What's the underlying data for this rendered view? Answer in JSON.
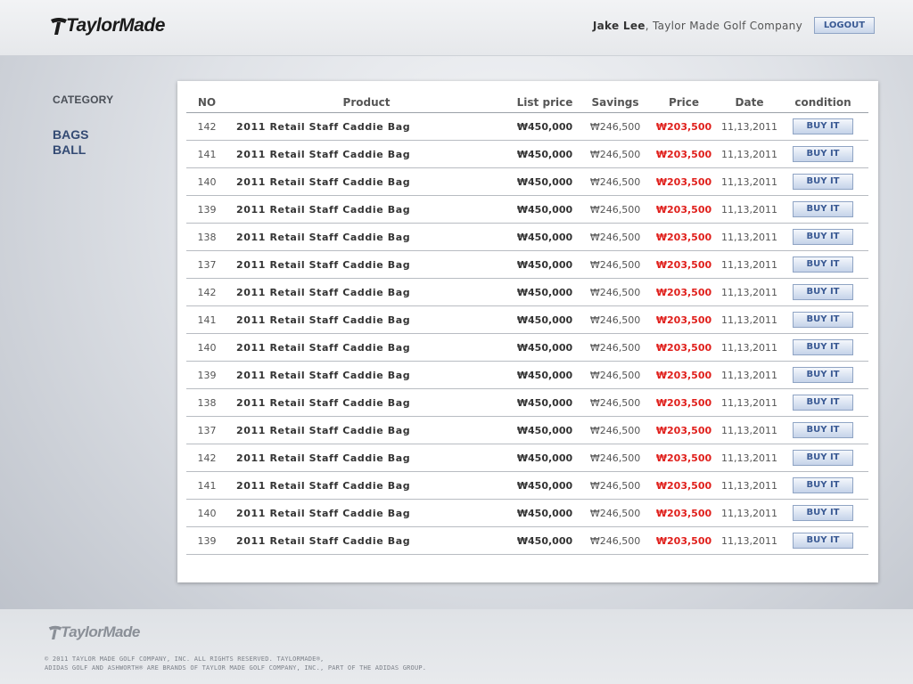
{
  "brand": {
    "name": "TaylorMade"
  },
  "header": {
    "user_name": "Jake Lee",
    "company": ", Taylor Made Golf Company",
    "logout_label": "LOGOUT"
  },
  "sidebar": {
    "title": "CATEGORY",
    "items": [
      {
        "label": "BAGS"
      },
      {
        "label": "BALL"
      }
    ]
  },
  "table": {
    "columns": [
      "NO",
      "Product",
      "List price",
      "Savings",
      "Price",
      "Date",
      "condition"
    ],
    "buy_label": "BUY IT",
    "rows": [
      {
        "no": "142",
        "product": "2011 Retail Staff Caddie Bag",
        "list_price": "₩450,000",
        "savings": "₩246,500",
        "price": "₩203,500",
        "date": "11,13,2011"
      },
      {
        "no": "141",
        "product": "2011 Retail Staff Caddie Bag",
        "list_price": "₩450,000",
        "savings": "₩246,500",
        "price": "₩203,500",
        "date": "11,13,2011"
      },
      {
        "no": "140",
        "product": "2011 Retail Staff Caddie Bag",
        "list_price": "₩450,000",
        "savings": "₩246,500",
        "price": "₩203,500",
        "date": "11,13,2011"
      },
      {
        "no": "139",
        "product": "2011 Retail Staff Caddie Bag",
        "list_price": "₩450,000",
        "savings": "₩246,500",
        "price": "₩203,500",
        "date": "11,13,2011"
      },
      {
        "no": "138",
        "product": "2011 Retail Staff Caddie Bag",
        "list_price": "₩450,000",
        "savings": "₩246,500",
        "price": "₩203,500",
        "date": "11,13,2011"
      },
      {
        "no": "137",
        "product": "2011 Retail Staff Caddie Bag",
        "list_price": "₩450,000",
        "savings": "₩246,500",
        "price": "₩203,500",
        "date": "11,13,2011"
      },
      {
        "no": "142",
        "product": "2011 Retail Staff Caddie Bag",
        "list_price": "₩450,000",
        "savings": "₩246,500",
        "price": "₩203,500",
        "date": "11,13,2011"
      },
      {
        "no": "141",
        "product": "2011 Retail Staff Caddie Bag",
        "list_price": "₩450,000",
        "savings": "₩246,500",
        "price": "₩203,500",
        "date": "11,13,2011"
      },
      {
        "no": "140",
        "product": "2011 Retail Staff Caddie Bag",
        "list_price": "₩450,000",
        "savings": "₩246,500",
        "price": "₩203,500",
        "date": "11,13,2011"
      },
      {
        "no": "139",
        "product": "2011 Retail Staff Caddie Bag",
        "list_price": "₩450,000",
        "savings": "₩246,500",
        "price": "₩203,500",
        "date": "11,13,2011"
      },
      {
        "no": "138",
        "product": "2011 Retail Staff Caddie Bag",
        "list_price": "₩450,000",
        "savings": "₩246,500",
        "price": "₩203,500",
        "date": "11,13,2011"
      },
      {
        "no": "137",
        "product": "2011 Retail Staff Caddie Bag",
        "list_price": "₩450,000",
        "savings": "₩246,500",
        "price": "₩203,500",
        "date": "11,13,2011"
      },
      {
        "no": "142",
        "product": "2011 Retail Staff Caddie Bag",
        "list_price": "₩450,000",
        "savings": "₩246,500",
        "price": "₩203,500",
        "date": "11,13,2011"
      },
      {
        "no": "141",
        "product": "2011 Retail Staff Caddie Bag",
        "list_price": "₩450,000",
        "savings": "₩246,500",
        "price": "₩203,500",
        "date": "11,13,2011"
      },
      {
        "no": "140",
        "product": "2011 Retail Staff Caddie Bag",
        "list_price": "₩450,000",
        "savings": "₩246,500",
        "price": "₩203,500",
        "date": "11,13,2011"
      },
      {
        "no": "139",
        "product": "2011 Retail Staff Caddie Bag",
        "list_price": "₩450,000",
        "savings": "₩246,500",
        "price": "₩203,500",
        "date": "11,13,2011"
      }
    ]
  },
  "footer": {
    "brand": "TaylorMade",
    "copyright_line1": "© 2011 TAYLOR MADE GOLF COMPANY, INC. ALL RIGHTS RESERVED. TAYLORMADE®,",
    "copyright_line2": "ADIDAS GOLF AND ASHWORTH® ARE BRANDS OF TAYLOR MADE GOLF COMPANY, INC., PART OF THE ADIDAS GROUP."
  },
  "colors": {
    "price_red": "#e0201c",
    "nav_blue": "#334a73",
    "button_blue": "#3a5a94"
  }
}
